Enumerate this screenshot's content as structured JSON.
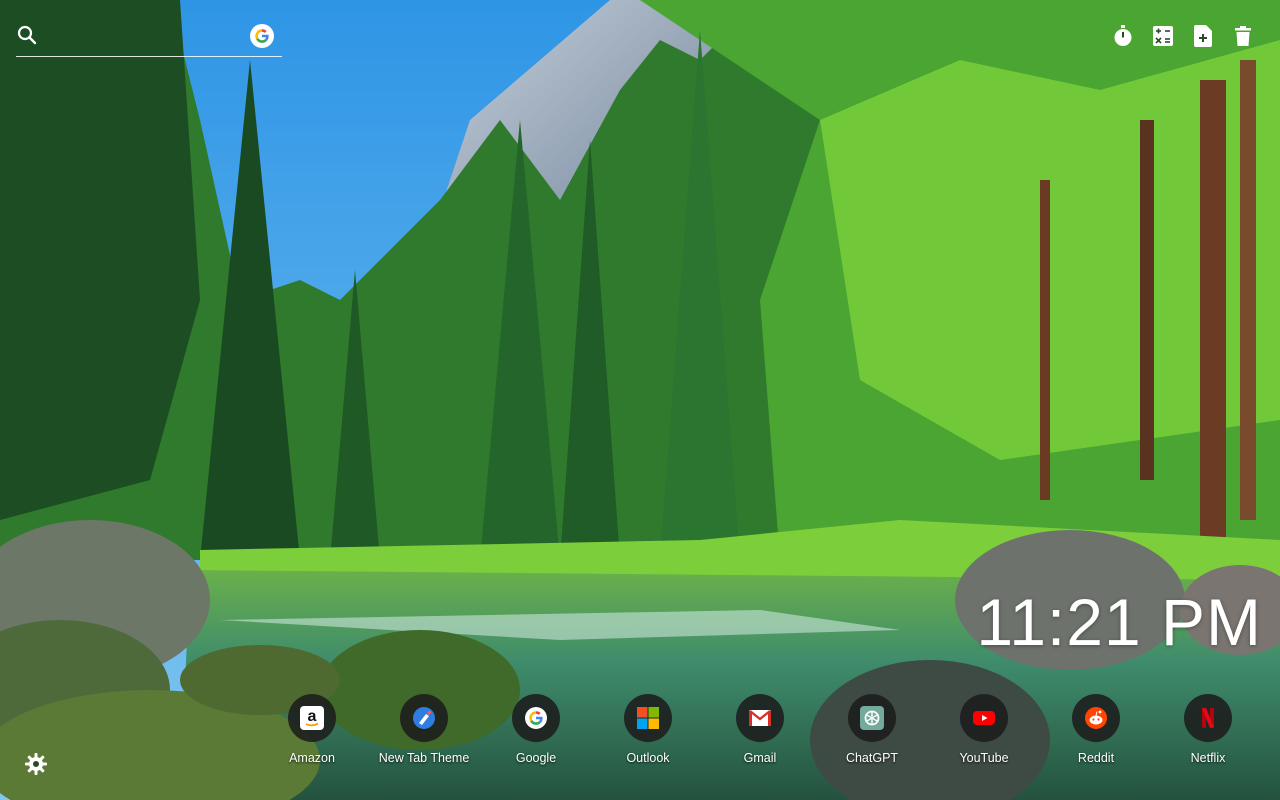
{
  "search": {
    "placeholder": "",
    "icon": "search-icon",
    "engine_icon": "google-icon"
  },
  "toolbar": {
    "items": [
      {
        "icon": "stopwatch-icon"
      },
      {
        "icon": "calculator-icon"
      },
      {
        "icon": "add-note-icon"
      },
      {
        "icon": "trash-icon"
      }
    ]
  },
  "clock": {
    "time": "11:21 PM"
  },
  "shortcuts": [
    {
      "label": "Amazon",
      "icon": "amazon-icon"
    },
    {
      "label": "New Tab Theme",
      "icon": "new-tab-theme-icon"
    },
    {
      "label": "Google",
      "icon": "google-icon"
    },
    {
      "label": "Outlook",
      "icon": "microsoft-icon"
    },
    {
      "label": "Gmail",
      "icon": "gmail-icon"
    },
    {
      "label": "ChatGPT",
      "icon": "chatgpt-icon"
    },
    {
      "label": "YouTube",
      "icon": "youtube-icon"
    },
    {
      "label": "Reddit",
      "icon": "reddit-icon"
    },
    {
      "label": "Netflix",
      "icon": "netflix-icon"
    }
  ],
  "settings": {
    "icon": "gear-icon"
  },
  "colors": {
    "sky": "#3aa0e8",
    "foliage": "#3f9a2e",
    "bright_foliage": "#86d93a",
    "water": "#3d8a6e",
    "rock": "#6f7a73",
    "shortcut_bg": "#1c1c1c"
  }
}
